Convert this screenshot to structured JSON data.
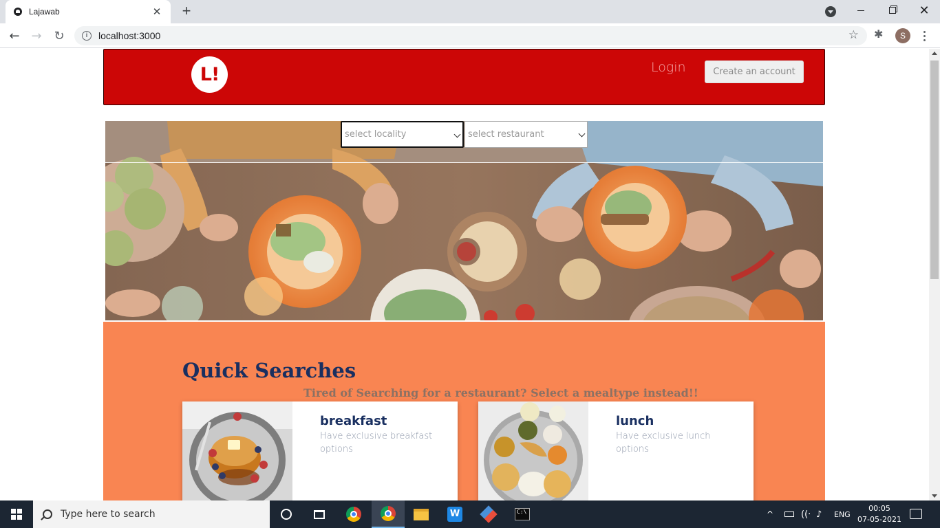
{
  "browser": {
    "tab_title": "Lajawab",
    "tab_close": "✕",
    "new_tab": "+",
    "url": "localhost:3000",
    "profile_initial": "S",
    "window_close": "✕"
  },
  "header": {
    "logo_text": "L!",
    "login": "Login",
    "create_account": "Create an account",
    "brand_color": "#cc0606"
  },
  "hero": {
    "locality_placeholder": "select locality",
    "restaurant_placeholder": "select restaurant"
  },
  "quick_searches": {
    "title": "Quick Searches",
    "subtitle": "Tired of Searching for a restaurant? Select a mealtype instead!!",
    "background_color": "#f98552",
    "cards": [
      {
        "title": "breakfast",
        "description": "Have exclusive breakfast options"
      },
      {
        "title": "lunch",
        "description": "Have exclusive lunch options"
      }
    ]
  },
  "taskbar": {
    "search_placeholder": "Type here to search",
    "language": "ENG",
    "time": "00:05",
    "date": "07-05-2021"
  }
}
